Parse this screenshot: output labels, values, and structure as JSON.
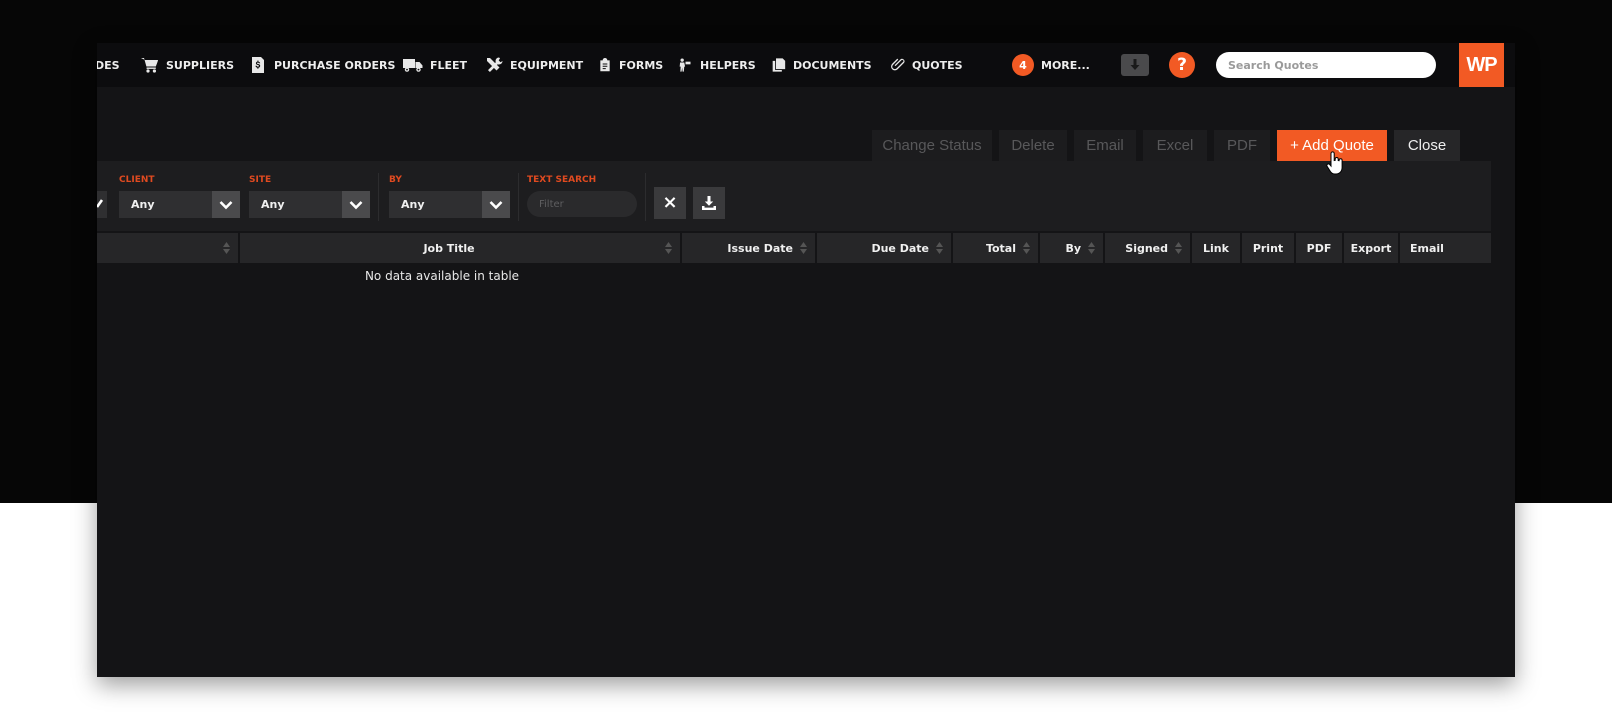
{
  "nav": {
    "items": [
      {
        "key": "codes",
        "label": "DES",
        "icon": "none"
      },
      {
        "key": "suppliers",
        "label": "SUPPLIERS",
        "icon": "cart-icon"
      },
      {
        "key": "purchase_orders",
        "label": "PURCHASE ORDERS",
        "icon": "dollar-document-icon"
      },
      {
        "key": "fleet",
        "label": "FLEET",
        "icon": "truck-icon"
      },
      {
        "key": "equipment",
        "label": "EQUIPMENT",
        "icon": "tools-icon"
      },
      {
        "key": "forms",
        "label": "FORMS",
        "icon": "clipboard-icon"
      },
      {
        "key": "helpers",
        "label": "HELPERS",
        "icon": "helper-icon"
      },
      {
        "key": "documents",
        "label": "DOCUMENTS",
        "icon": "copy-icon"
      },
      {
        "key": "quotes",
        "label": "QUOTES",
        "icon": "paperclip-icon"
      }
    ],
    "more_count": "4",
    "more_label": "MORE...",
    "help_label": "?",
    "search_placeholder": "Search Quotes",
    "logo_text": "WP"
  },
  "actions": {
    "change_status": "Change Status",
    "delete": "Delete",
    "email": "Email",
    "excel": "Excel",
    "pdf": "PDF",
    "add_quote": "+ Add Quote",
    "close": "Close"
  },
  "filters": {
    "client": {
      "label": "CLIENT",
      "value": "Any"
    },
    "site": {
      "label": "SITE",
      "value": "Any"
    },
    "by": {
      "label": "BY",
      "value": "Any"
    },
    "text_search": {
      "label": "TEXT SEARCH",
      "placeholder": "Filter"
    },
    "clear_label": "×"
  },
  "table": {
    "columns": {
      "first": "",
      "job_title": "Job Title",
      "issue_date": "Issue Date",
      "due_date": "Due Date",
      "total": "Total",
      "by": "By",
      "signed": "Signed",
      "link": "Link",
      "print": "Print",
      "pdf": "PDF",
      "export": "Export",
      "email": "Email"
    },
    "empty_message": "No data available in table"
  },
  "colors": {
    "accent": "#f25a24",
    "label": "#e04a20",
    "app_bg": "#141416"
  }
}
